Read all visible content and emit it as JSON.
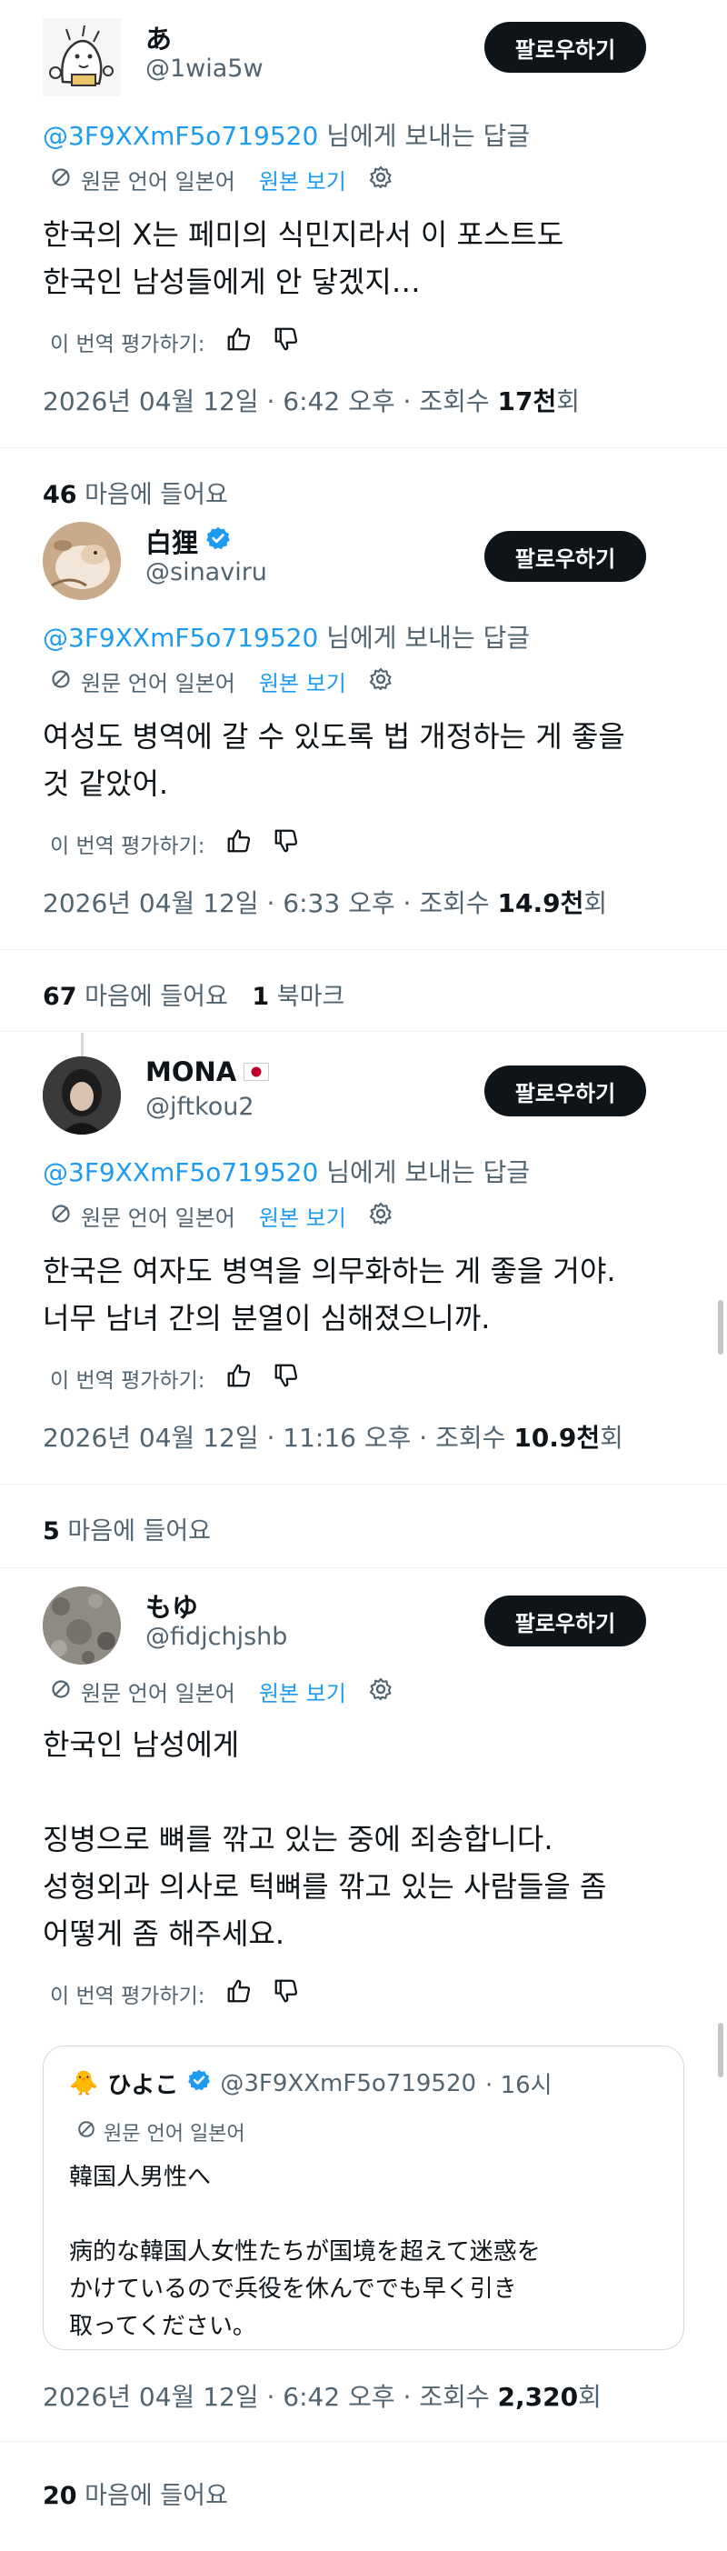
{
  "common": {
    "follow_label": "팔로우하기",
    "reply_suffix": "님에게 보내는 답글",
    "source_lang": "원문 언어 일본어",
    "show_original": "원본 보기",
    "rate_translation": "이 번역 평가하기:",
    "views_label": "조회수",
    "likes_suffix": "마음에 들어요",
    "bookmarks_suffix": "북마크"
  },
  "colors": {
    "accent": "#1d9bf0",
    "text": "#0f1419",
    "muted": "#536471",
    "verified": "#1d9bf0"
  },
  "posts": [
    {
      "name": "あ",
      "handle": "@1wia5w",
      "reply_to": "@3F9XXmF5o719520",
      "text": "한국의 X는 페미의 식민지라서 이 포스트도\n한국인 남성들에게 안 닿겠지…",
      "timestamp": "2026년 04월 12일 · 6:42 오후 ·",
      "views": "17천",
      "views_unit": "회",
      "likes": "46"
    },
    {
      "name": "白狸",
      "handle": "@sinaviru",
      "reply_to": "@3F9XXmF5o719520",
      "text": "여성도 병역에 갈 수 있도록 법 개정하는 게 좋을\n것 같았어.",
      "timestamp": "2026년 04월 12일 · 6:33 오후 ·",
      "views": "14.9천",
      "views_unit": "회",
      "likes": "67",
      "bookmarks": "1"
    },
    {
      "name": "MONA",
      "flag": "🇯🇵",
      "handle": "@jftkou2",
      "reply_to": "@3F9XXmF5o719520",
      "text": "한국은 여자도 병역을 의무화하는 게 좋을 거야.\n너무 남녀 간의 분열이 심해졌으니까.",
      "timestamp": "2026년 04월 12일 · 11:16 오후 ·",
      "views": "10.9천",
      "views_unit": "회",
      "likes": "5"
    },
    {
      "name": "もゆ",
      "handle": "@fidjchjshb",
      "text": "한국인 남성에게\n\n징병으로 뼈를 깎고 있는 중에 죄송합니다.\n성형외과 의사로 턱뼈를 깎고 있는 사람들을 좀\n어떻게 좀 해주세요.",
      "timestamp": "2026년 04월 12일 · 6:42 오후 ·",
      "views": "2,320",
      "views_unit": "회",
      "likes": "20",
      "quote": {
        "emoji": "🐥",
        "name": "ひよこ",
        "handle": "@3F9XXmF5o719520",
        "time": "· 16시",
        "source_lang": "원문 언어 일본어",
        "text": "韓国人男性へ\n\n病的な韓国人女性たちが国境を超えて迷惑を\nかけているので兵役を休んででも早く引き\n取ってください。"
      }
    }
  ],
  "icons": {
    "translate": "translate-icon",
    "gear": "gear-icon",
    "thumb_up": "thumbs-up-icon",
    "thumb_down": "thumbs-down-icon",
    "verified": "verified-badge-icon"
  }
}
